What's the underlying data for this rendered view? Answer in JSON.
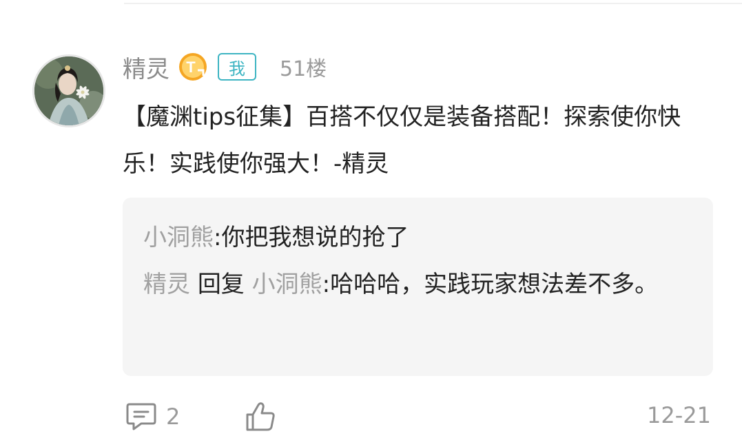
{
  "post": {
    "username": "精灵",
    "level_badge_letter": "T",
    "self_tag": "我",
    "floor": "51楼",
    "content": "【魔渊tips征集】百搭不仅仅是装备搭配！探索使你快乐！实践使你强大！-精灵"
  },
  "replies": [
    {
      "author": "小洞熊",
      "separator": ":",
      "text": "你把我想说的抢了"
    },
    {
      "author": "精灵",
      "reply_word": "回复",
      "target": "小洞熊",
      "separator": ":",
      "text": "哈哈哈，实践玩家想法差不多。"
    }
  ],
  "footer": {
    "comment_count": "2",
    "date": "12-21"
  },
  "icons": {
    "avatar": "user-avatar",
    "badge": "level-badge-icon",
    "comment": "comment-icon",
    "like": "thumbs-up-icon"
  },
  "colors": {
    "accent": "#3cb4c2",
    "badge": "#f5a623",
    "muted": "#9a9a9a",
    "reply_bg": "#f5f5f5"
  }
}
